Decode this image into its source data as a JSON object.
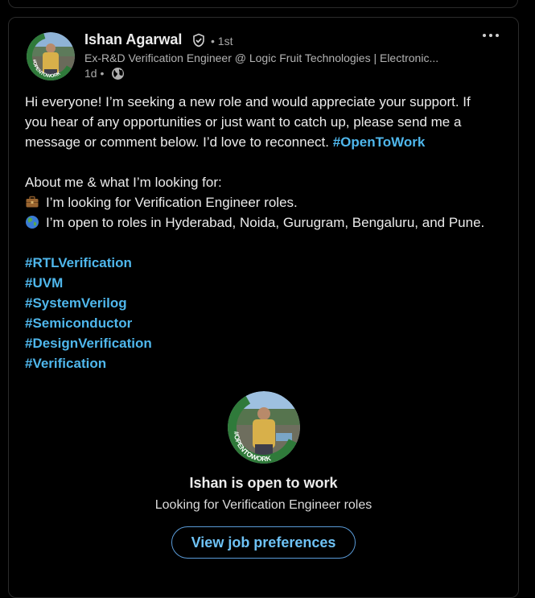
{
  "post": {
    "author": {
      "name": "Ishan Agarwal",
      "degree": "• 1st",
      "headline": "Ex-R&D Verification Engineer @ Logic Fruit Technologies | Electronic...",
      "time": "1d •",
      "avatar_badge_text": "#OPENTOWORK"
    },
    "menu_icon": "more-horizontal-icon",
    "lines": {
      "l1": "Hi everyone! I’m seeking a new role and would appreciate your support. If",
      "l2": "you hear of any opportunities or just want to catch up, please send me a",
      "l3": "message or comment below. I’d love to reconnect. ",
      "l3_tag": "#OpenToWork",
      "l4": "About me & what I’m looking for:",
      "l5": "I’m looking for Verification Engineer roles.",
      "l6": "I’m open to roles in Hyderabad, Noida, Gurugram, Bengaluru, and Pune."
    },
    "hashtags": [
      "#RTLVerification",
      "#UVM",
      "#SystemVerilog",
      "#Semiconductor",
      "#DesignVerification",
      "#Verification"
    ],
    "open_to_work": {
      "title": "Ishan is open to work",
      "subtitle": "Looking for Verification Engineer roles",
      "button": "View job preferences",
      "badge_text": "#OPENTOWORK"
    }
  },
  "colors": {
    "background": "#000000",
    "hashtag": "#4fb7ec",
    "open_to_work_ring": "#2f7a3a",
    "button_border": "#5a9bd8"
  }
}
